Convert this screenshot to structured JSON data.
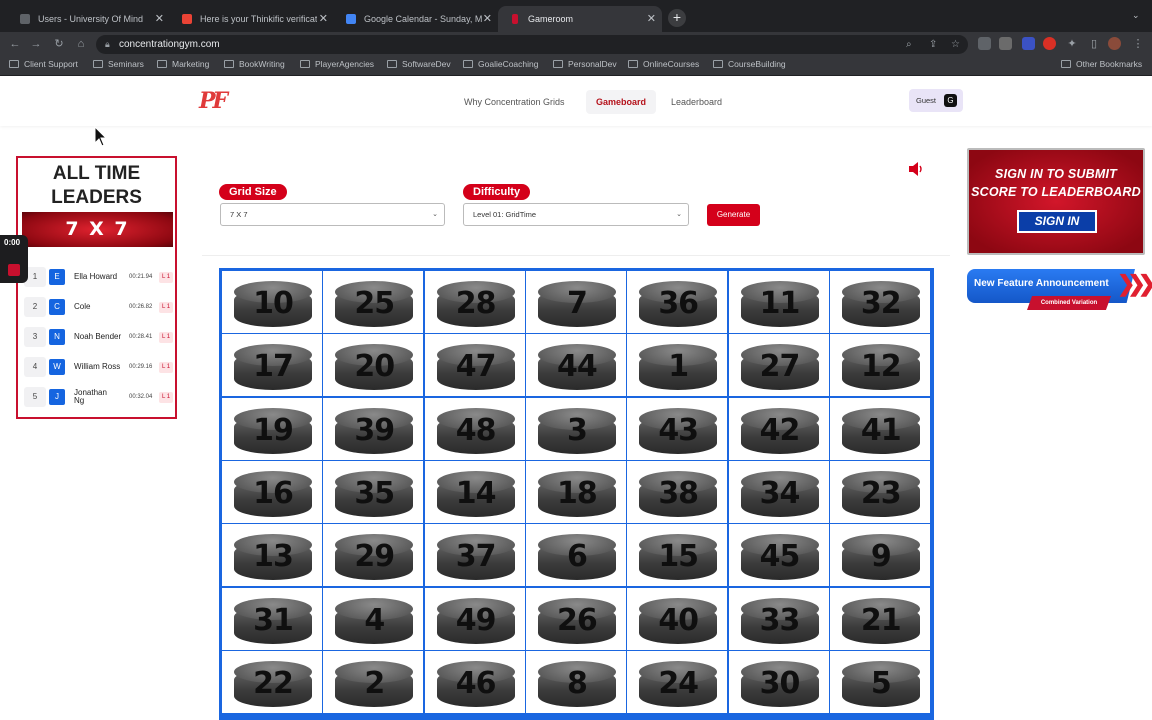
{
  "browser": {
    "tabs": [
      {
        "label": "Users - University Of Mind",
        "active": false,
        "favicon_color": "#5f6368"
      },
      {
        "label": "Here is your Thinkific verificat",
        "active": false,
        "favicon_color": "#ea4335"
      },
      {
        "label": "Google Calendar - Sunday, Ma",
        "active": false,
        "favicon_color": "#4285f4"
      },
      {
        "label": "Gameroom",
        "active": true,
        "favicon_color": "#c8102e"
      }
    ],
    "new_tab": "+",
    "url": "concentrationgym.com",
    "bookmarks": [
      "Client Support",
      "Seminars",
      "Marketing",
      "BookWriting",
      "PlayerAgencies",
      "SoftwareDev",
      "GoalieCoaching",
      "PersonalDev",
      "OnlineCourses",
      "CourseBuilding"
    ],
    "other_bookmarks": "Other Bookmarks"
  },
  "site": {
    "logo": "PF",
    "nav": [
      {
        "label": "Why Concentration Grids",
        "selected": false
      },
      {
        "label": "Gameboard",
        "selected": true
      },
      {
        "label": "Leaderboard",
        "selected": false
      }
    ],
    "guest": {
      "label": "Guest",
      "initial": "G"
    }
  },
  "leaders": {
    "title": "ALL TIME LEADERS",
    "grid": "7 X 7",
    "rows": [
      {
        "rank": "1",
        "initial": "E",
        "name": "Ella Howard",
        "time": "00:21.94",
        "level": "L 1"
      },
      {
        "rank": "2",
        "initial": "C",
        "name": "Cole",
        "time": "00:26.82",
        "level": "L 1"
      },
      {
        "rank": "3",
        "initial": "N",
        "name": "Noah Bender",
        "time": "00:28.41",
        "level": "L 1"
      },
      {
        "rank": "4",
        "initial": "W",
        "name": "William Ross",
        "time": "00:29.16",
        "level": "L 1"
      },
      {
        "rank": "5",
        "initial": "J",
        "name": "Jonathan Ng",
        "time": "00:32.04",
        "level": "L 1"
      }
    ]
  },
  "recorder": {
    "time": "0:00"
  },
  "controls": {
    "grid_size_label": "Grid Size",
    "grid_size_value": "7 X 7",
    "difficulty_label": "Difficulty",
    "difficulty_value": "Level 01: GridTime",
    "generate_label": "Generate"
  },
  "board": {
    "rows": [
      [
        "10",
        "25",
        "28",
        "7",
        "36",
        "11",
        "32"
      ],
      [
        "17",
        "20",
        "47",
        "44",
        "1",
        "27",
        "12"
      ],
      [
        "19",
        "39",
        "48",
        "3",
        "43",
        "42",
        "41"
      ],
      [
        "16",
        "35",
        "14",
        "18",
        "38",
        "34",
        "23"
      ],
      [
        "13",
        "29",
        "37",
        "6",
        "15",
        "45",
        "9"
      ],
      [
        "31",
        "4",
        "49",
        "26",
        "40",
        "33",
        "21"
      ],
      [
        "22",
        "2",
        "46",
        "8",
        "24",
        "30",
        "5"
      ]
    ]
  },
  "ads": {
    "signin_line1": "SIGN IN TO SUBMIT",
    "signin_line2": "SCORE TO LEADERBOARD",
    "signin_button": "SIGN IN",
    "feature_title": "New Feature Announcement",
    "feature_sub": "Combined Variation"
  }
}
